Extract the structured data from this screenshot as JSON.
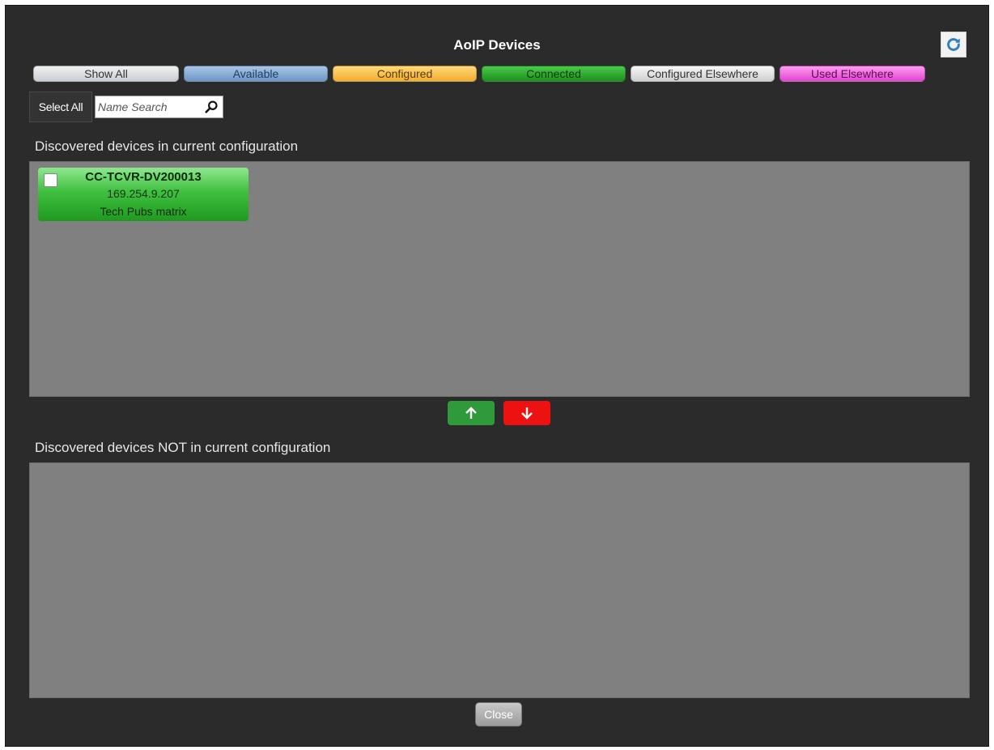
{
  "dialog": {
    "title": "AoIP Devices"
  },
  "toolbar": {
    "refresh_icon": "refresh-icon",
    "filters": [
      "Show All",
      "Available",
      "Configured",
      "Connected",
      "Configured Elsewhere",
      "Used Elsewhere"
    ],
    "filter_colors": {
      "available": "#7fa6d0",
      "configured": "#f7c04a",
      "connected": "#2faa2f",
      "configured_elsewhere": "#d9d9d9",
      "used_elsewhere": "#ee66de"
    },
    "select_all_label": "Select All",
    "search_placeholder": "Name Search",
    "search_icon": "search-icon"
  },
  "configured_section": {
    "label": "Discovered devices in current configuration",
    "devices": [
      {
        "name": "CC-TCVR-DV200013",
        "ip": "169.254.9.207",
        "matrix": "Tech Pubs matrix",
        "status": "Connected",
        "checked": false
      }
    ]
  },
  "move_controls": {
    "up_icon": "arrow-up-icon",
    "up_color": "#2f9a3a",
    "down_icon": "arrow-down-icon",
    "down_color": "#ee1111"
  },
  "unconfigured_section": {
    "label": "Discovered devices NOT in current configuration",
    "devices": []
  },
  "footer": {
    "close_label": "Close"
  }
}
